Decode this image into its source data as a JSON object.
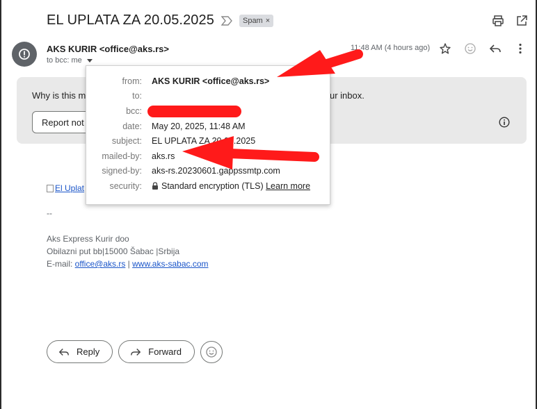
{
  "email": {
    "subject": "EL UPLATA ZA 20.05.2025",
    "spam_label": "Spam",
    "sender": "AKS KURIR <office@aks.rs>",
    "to_line": "to bcc: me",
    "time": "11:48 AM (4 hours ago)"
  },
  "warning": {
    "text_left": "Why is this m",
    "text_right": "ur inbox.",
    "report_label": "Report not"
  },
  "details": {
    "from_label": "from:",
    "from_value": "AKS KURIR <office@aks.rs>",
    "to_label": "to:",
    "bcc_label": "bcc:",
    "date_label": "date:",
    "date_value": "May 20, 2025, 11:48 AM",
    "subject_label": "subject:",
    "subject_value": "EL UPLATA ZA 20.05.2025",
    "mailed_by_label": "mailed-by:",
    "mailed_by_value": "aks.rs",
    "signed_by_label": "signed-by:",
    "signed_by_value": "aks-rs.20230601.gappssmtp.com",
    "security_label": "security:",
    "security_value": "Standard encryption (TLS)",
    "learn_more": "Learn more"
  },
  "body": {
    "img_alt": "El Uplat",
    "dashes": "--",
    "company": "Aks Express Kurir doo",
    "address": "Obilazni put bb|15000 Šabac |Srbija",
    "email_prefix": "E-mail: ",
    "email_link": "office@aks.rs",
    "separator": " | ",
    "website_link": "www.aks-sabac.com"
  },
  "actions": {
    "reply": "Reply",
    "forward": "Forward"
  },
  "icons": [
    "important-marker-icon",
    "print-icon",
    "open-new-window-icon",
    "spam-alert-icon",
    "star-icon",
    "emoji-icon",
    "reply-icon",
    "more-vert-icon",
    "info-icon",
    "lock-icon",
    "forward-icon"
  ],
  "colors": {
    "annotation_red": "#ff1a1a",
    "link_blue": "#1a55c9",
    "warning_bg": "#e9e9e9"
  }
}
